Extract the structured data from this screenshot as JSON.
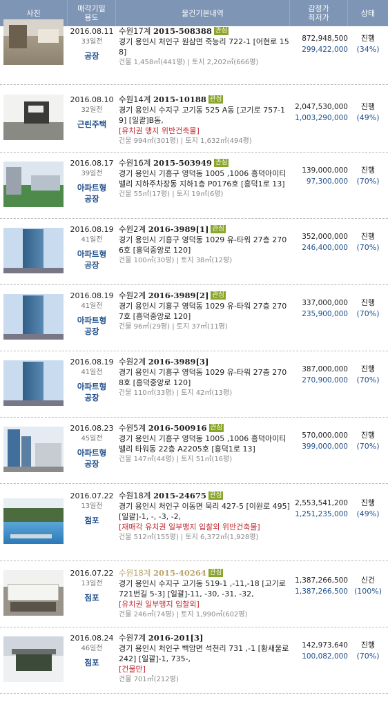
{
  "header": {
    "photo": "사진",
    "date_line1": "매각기일",
    "date_line2": "용도",
    "info": "물건기본내역",
    "price_line1": "감정가",
    "price_line2": "최저가",
    "status": "상태"
  },
  "rows": [
    {
      "date": "2016.08.11",
      "days": "33일전",
      "usage1": "공장",
      "usage2": "",
      "court": "수원17계",
      "case_no": "2015-508388",
      "badge": "관심",
      "address": "경기 용인시 처인구 원삼면 죽능리 722-1 [어현로 158]",
      "warning": "",
      "area": "건물 1,458㎡(441평) | 토지 2,202㎡(666평)",
      "appraise": "872,948,500",
      "minimum": "299,422,000",
      "status": "진행",
      "percent": "(34%)"
    },
    {
      "date": "2016.08.10",
      "days": "32일전",
      "usage1": "근린주택",
      "usage2": "",
      "court": "수원14계",
      "case_no": "2015-10188",
      "badge": "관심",
      "address": "경기 용인시 수지구 고기동 525 A동 [고기로 757-19] [일괄]B동,",
      "warning": "[유치권  맹지 위반건축물]",
      "area": "건물 994㎡(301평) | 토지 1,632㎡(494평)",
      "appraise": "2,047,530,000",
      "minimum": "1,003,290,000",
      "status": "진행",
      "percent": "(49%)"
    },
    {
      "date": "2016.08.17",
      "days": "39일전",
      "usage1": "아파트형",
      "usage2": "공장",
      "court": "수원16계",
      "case_no": "2015-503949",
      "badge": "관심",
      "address": "경기 용인시 기흥구 영덕동 1005 ,1006 흥덕아이티밸리 지하주차장동 지하1층 P0176호 [흥덕1로 13]",
      "warning": "",
      "area": "건물 55㎡(17평) | 토지 19㎡(6평)",
      "appraise": "139,000,000",
      "minimum": "97,300,000",
      "status": "진행",
      "percent": "(70%)"
    },
    {
      "date": "2016.08.19",
      "days": "41일전",
      "usage1": "아파트형",
      "usage2": "공장",
      "court": "수원2계",
      "case_no": "2016-3989[1]",
      "badge": "관심",
      "address": "경기 용인시 기흥구 영덕동 1029 유-타워 27층 2706호 [흥덕중앙로 120]",
      "warning": "",
      "area": "건물 100㎡(30평) | 토지 38㎡(12평)",
      "appraise": "352,000,000",
      "minimum": "246,400,000",
      "status": "진행",
      "percent": "(70%)"
    },
    {
      "date": "2016.08.19",
      "days": "41일전",
      "usage1": "아파트형",
      "usage2": "공장",
      "court": "수원2계",
      "case_no": "2016-3989[2]",
      "badge": "관심",
      "address": "경기 용인시 기흥구 영덕동 1029 유-타워 27층 2707호 [흥덕중앙로 120]",
      "warning": "",
      "area": "건물 96㎡(29평) | 토지 37㎡(11평)",
      "appraise": "337,000,000",
      "minimum": "235,900,000",
      "status": "진행",
      "percent": "(70%)"
    },
    {
      "date": "2016.08.19",
      "days": "41일전",
      "usage1": "아파트형",
      "usage2": "공장",
      "court": "수원2계",
      "case_no": "2016-3989[3]",
      "badge": "",
      "address": "경기 용인시 기흥구 영덕동 1029 유-타워 27층 2708호 [흥덕중앙로 120]",
      "warning": "",
      "area": "건물 110㎡(33평) | 토지 42㎡(13평)",
      "appraise": "387,000,000",
      "minimum": "270,900,000",
      "status": "진행",
      "percent": "(70%)"
    },
    {
      "date": "2016.08.23",
      "days": "45일전",
      "usage1": "아파트형",
      "usage2": "공장",
      "court": "수원5계",
      "case_no": "2016-500916",
      "badge": "관심",
      "address": "경기 용인시 기흥구 영덕동 1005 ,1006 흥덕아이티밸리 타워동 22층 A2205호 [흥덕1로 13]",
      "warning": "",
      "area": "건물 147㎡(44평) | 토지 51㎡(16평)",
      "appraise": "570,000,000",
      "minimum": "399,000,000",
      "status": "진행",
      "percent": "(70%)"
    },
    {
      "date": "2016.07.22",
      "days": "13일전",
      "usage1": "점포",
      "usage2": "",
      "court": "수원18계",
      "case_no": "2015-24675",
      "badge": "관심",
      "address": "경기 용인시 처인구 이동면 묵리 427-5 [이원로 495] [일괄]-1, -, -3, -2,",
      "warning": "[재매각  유치권  일부맹지 입찰외  위반건축물]",
      "area": "건물 512㎡(155평) | 토지 6,372㎡(1,928평)",
      "appraise": "2,553,541,200",
      "minimum": "1,251,235,000",
      "status": "진행",
      "percent": "(49%)"
    },
    {
      "date": "2016.07.22",
      "days": "13일전",
      "usage1": "점포",
      "usage2": "",
      "court": "수원18계",
      "case_no": "2015-40264",
      "badge": "관심",
      "faded": true,
      "address": "경기 용인시 수지구 고기동 519-1 ,-11,-18 [고기로721번길 5-3] [일괄]-11, -30, -31, -32,",
      "warning": "[유치권  일부맹지 입찰외]",
      "area": "건물 246㎡(74평) | 토지 1,990㎡(602평)",
      "appraise": "1,387,266,500",
      "minimum": "1,387,266,500",
      "status": "신건",
      "percent": "(100%)"
    },
    {
      "date": "2016.08.24",
      "days": "46일전",
      "usage1": "점포",
      "usage2": "",
      "court": "수원7계",
      "case_no": "2016-201[3]",
      "badge": "",
      "address": "경기 용인시 처인구 백암면 석천리 731 ,-1 [황새울로 242] [일괄]-1, 735-,",
      "warning": "[건물만]",
      "area": "건물 701㎡(212평)",
      "appraise": "142,973,640",
      "minimum": "100,082,000",
      "status": "진행",
      "percent": "(70%)"
    }
  ]
}
